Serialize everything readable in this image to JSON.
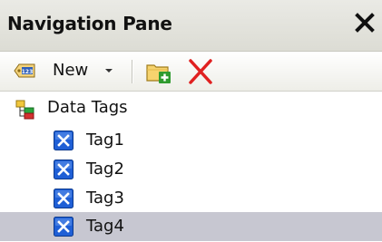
{
  "header": {
    "title": "Navigation Pane",
    "close_icon": "close-icon"
  },
  "toolbar": {
    "new_label": "New",
    "new_icon": "tag-123-icon",
    "add_folder_icon": "add-folder-icon",
    "delete_icon": "delete-icon"
  },
  "tree": {
    "root": {
      "label": "Data Tags",
      "icon": "data-tags-icon"
    },
    "items": [
      {
        "label": "Tag1",
        "icon": "tag-icon",
        "selected": false
      },
      {
        "label": "Tag2",
        "icon": "tag-icon",
        "selected": false
      },
      {
        "label": "Tag3",
        "icon": "tag-icon",
        "selected": false
      },
      {
        "label": "Tag4",
        "icon": "tag-icon",
        "selected": true
      }
    ]
  },
  "colors": {
    "selection": "#c7c7d1",
    "delete_red": "#e02020",
    "tag_blue": "#1f5fd6"
  }
}
